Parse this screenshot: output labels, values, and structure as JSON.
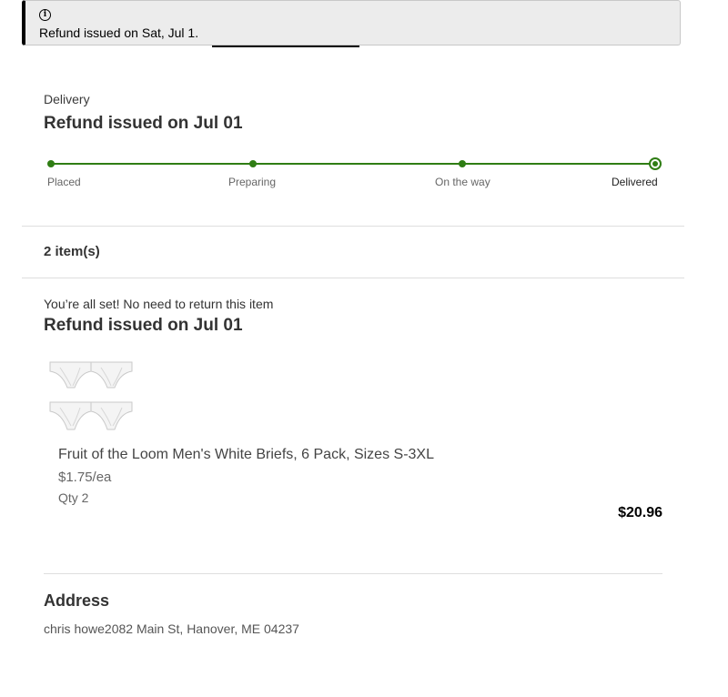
{
  "banner": {
    "icon": "info-icon",
    "message": "Refund issued on Sat, Jul 1."
  },
  "delivery": {
    "eyebrow": "Delivery",
    "title": "Refund issued on Jul 01",
    "steps": [
      {
        "label": "Placed",
        "state": "complete"
      },
      {
        "label": "Preparing",
        "state": "complete"
      },
      {
        "label": "On the way",
        "state": "complete"
      },
      {
        "label": "Delivered",
        "state": "current"
      }
    ],
    "track_color": "#2f7d14"
  },
  "items": {
    "count_label": "2 item(s)"
  },
  "refund": {
    "note": "You’re all set! No need to return this item",
    "title": "Refund issued on Jul 01"
  },
  "product": {
    "image": "white-briefs-6-pack-image",
    "name": "Fruit of the Loom Men's White Briefs, 6 Pack, Sizes S-3XL",
    "unit_price": "$1.75/ea",
    "quantity": "Qty 2",
    "total": "$20.96"
  },
  "address": {
    "title": "Address",
    "text": "chris howe2082 Main St, Hanover, ME 04237"
  }
}
